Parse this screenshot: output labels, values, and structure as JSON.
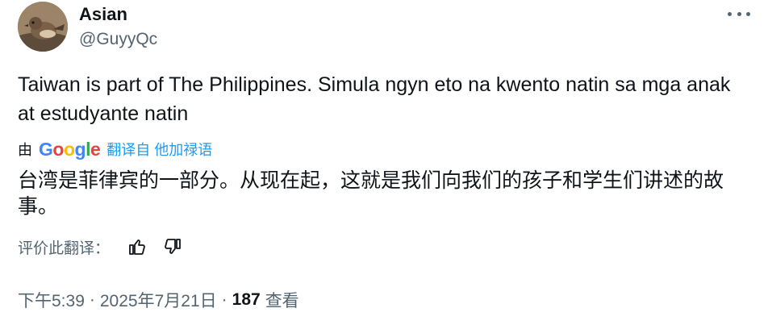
{
  "author": {
    "display_name": "Asian",
    "handle": "@GuyyQc"
  },
  "more_menu_icon": "more-horizontal-icon",
  "tweet": {
    "text": "Taiwan is part of The Philippines. Simula ngyn eto na kwento natin sa mga anak at estudyante natin"
  },
  "translation": {
    "by_label": "由",
    "provider_letters": [
      "G",
      "o",
      "o",
      "g",
      "l",
      "e"
    ],
    "provider_colors": [
      "#4285F4",
      "#EA4335",
      "#FBBC05",
      "#4285F4",
      "#34A853",
      "#EA4335"
    ],
    "link_label": "翻译自 他加禄语",
    "translated_text": "台湾是菲律宾的一部分。从现在起，这就是我们向我们的孩子和学生们讲述的故事。"
  },
  "rating": {
    "label": "评价此翻译：",
    "thumbs_up_icon": "thumbs-up-icon",
    "thumbs_down_icon": "thumbs-down-icon"
  },
  "meta": {
    "time": "下午5:39",
    "separator": "·",
    "date": "2025年7月21日",
    "views_count": "187",
    "views_label": "查看"
  },
  "colors": {
    "text_primary": "#0f1419",
    "text_secondary": "#536471",
    "accent": "#1d9bf0"
  }
}
